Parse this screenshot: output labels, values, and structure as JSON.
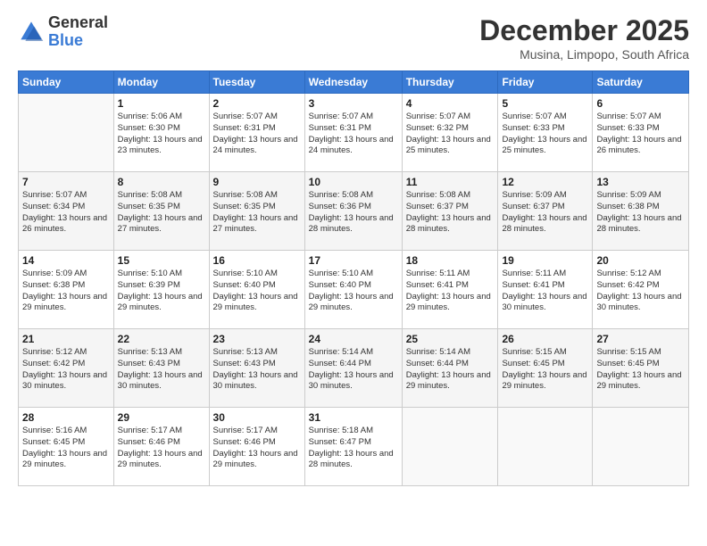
{
  "header": {
    "logo_line1": "General",
    "logo_line2": "Blue",
    "month": "December 2025",
    "location": "Musina, Limpopo, South Africa"
  },
  "weekdays": [
    "Sunday",
    "Monday",
    "Tuesday",
    "Wednesday",
    "Thursday",
    "Friday",
    "Saturday"
  ],
  "weeks": [
    [
      {
        "day": "",
        "sunrise": "",
        "sunset": "",
        "daylight": ""
      },
      {
        "day": "1",
        "sunrise": "Sunrise: 5:06 AM",
        "sunset": "Sunset: 6:30 PM",
        "daylight": "Daylight: 13 hours and 23 minutes."
      },
      {
        "day": "2",
        "sunrise": "Sunrise: 5:07 AM",
        "sunset": "Sunset: 6:31 PM",
        "daylight": "Daylight: 13 hours and 24 minutes."
      },
      {
        "day": "3",
        "sunrise": "Sunrise: 5:07 AM",
        "sunset": "Sunset: 6:31 PM",
        "daylight": "Daylight: 13 hours and 24 minutes."
      },
      {
        "day": "4",
        "sunrise": "Sunrise: 5:07 AM",
        "sunset": "Sunset: 6:32 PM",
        "daylight": "Daylight: 13 hours and 25 minutes."
      },
      {
        "day": "5",
        "sunrise": "Sunrise: 5:07 AM",
        "sunset": "Sunset: 6:33 PM",
        "daylight": "Daylight: 13 hours and 25 minutes."
      },
      {
        "day": "6",
        "sunrise": "Sunrise: 5:07 AM",
        "sunset": "Sunset: 6:33 PM",
        "daylight": "Daylight: 13 hours and 26 minutes."
      }
    ],
    [
      {
        "day": "7",
        "sunrise": "Sunrise: 5:07 AM",
        "sunset": "Sunset: 6:34 PM",
        "daylight": "Daylight: 13 hours and 26 minutes."
      },
      {
        "day": "8",
        "sunrise": "Sunrise: 5:08 AM",
        "sunset": "Sunset: 6:35 PM",
        "daylight": "Daylight: 13 hours and 27 minutes."
      },
      {
        "day": "9",
        "sunrise": "Sunrise: 5:08 AM",
        "sunset": "Sunset: 6:35 PM",
        "daylight": "Daylight: 13 hours and 27 minutes."
      },
      {
        "day": "10",
        "sunrise": "Sunrise: 5:08 AM",
        "sunset": "Sunset: 6:36 PM",
        "daylight": "Daylight: 13 hours and 28 minutes."
      },
      {
        "day": "11",
        "sunrise": "Sunrise: 5:08 AM",
        "sunset": "Sunset: 6:37 PM",
        "daylight": "Daylight: 13 hours and 28 minutes."
      },
      {
        "day": "12",
        "sunrise": "Sunrise: 5:09 AM",
        "sunset": "Sunset: 6:37 PM",
        "daylight": "Daylight: 13 hours and 28 minutes."
      },
      {
        "day": "13",
        "sunrise": "Sunrise: 5:09 AM",
        "sunset": "Sunset: 6:38 PM",
        "daylight": "Daylight: 13 hours and 28 minutes."
      }
    ],
    [
      {
        "day": "14",
        "sunrise": "Sunrise: 5:09 AM",
        "sunset": "Sunset: 6:38 PM",
        "daylight": "Daylight: 13 hours and 29 minutes."
      },
      {
        "day": "15",
        "sunrise": "Sunrise: 5:10 AM",
        "sunset": "Sunset: 6:39 PM",
        "daylight": "Daylight: 13 hours and 29 minutes."
      },
      {
        "day": "16",
        "sunrise": "Sunrise: 5:10 AM",
        "sunset": "Sunset: 6:40 PM",
        "daylight": "Daylight: 13 hours and 29 minutes."
      },
      {
        "day": "17",
        "sunrise": "Sunrise: 5:10 AM",
        "sunset": "Sunset: 6:40 PM",
        "daylight": "Daylight: 13 hours and 29 minutes."
      },
      {
        "day": "18",
        "sunrise": "Sunrise: 5:11 AM",
        "sunset": "Sunset: 6:41 PM",
        "daylight": "Daylight: 13 hours and 29 minutes."
      },
      {
        "day": "19",
        "sunrise": "Sunrise: 5:11 AM",
        "sunset": "Sunset: 6:41 PM",
        "daylight": "Daylight: 13 hours and 30 minutes."
      },
      {
        "day": "20",
        "sunrise": "Sunrise: 5:12 AM",
        "sunset": "Sunset: 6:42 PM",
        "daylight": "Daylight: 13 hours and 30 minutes."
      }
    ],
    [
      {
        "day": "21",
        "sunrise": "Sunrise: 5:12 AM",
        "sunset": "Sunset: 6:42 PM",
        "daylight": "Daylight: 13 hours and 30 minutes."
      },
      {
        "day": "22",
        "sunrise": "Sunrise: 5:13 AM",
        "sunset": "Sunset: 6:43 PM",
        "daylight": "Daylight: 13 hours and 30 minutes."
      },
      {
        "day": "23",
        "sunrise": "Sunrise: 5:13 AM",
        "sunset": "Sunset: 6:43 PM",
        "daylight": "Daylight: 13 hours and 30 minutes."
      },
      {
        "day": "24",
        "sunrise": "Sunrise: 5:14 AM",
        "sunset": "Sunset: 6:44 PM",
        "daylight": "Daylight: 13 hours and 30 minutes."
      },
      {
        "day": "25",
        "sunrise": "Sunrise: 5:14 AM",
        "sunset": "Sunset: 6:44 PM",
        "daylight": "Daylight: 13 hours and 29 minutes."
      },
      {
        "day": "26",
        "sunrise": "Sunrise: 5:15 AM",
        "sunset": "Sunset: 6:45 PM",
        "daylight": "Daylight: 13 hours and 29 minutes."
      },
      {
        "day": "27",
        "sunrise": "Sunrise: 5:15 AM",
        "sunset": "Sunset: 6:45 PM",
        "daylight": "Daylight: 13 hours and 29 minutes."
      }
    ],
    [
      {
        "day": "28",
        "sunrise": "Sunrise: 5:16 AM",
        "sunset": "Sunset: 6:45 PM",
        "daylight": "Daylight: 13 hours and 29 minutes."
      },
      {
        "day": "29",
        "sunrise": "Sunrise: 5:17 AM",
        "sunset": "Sunset: 6:46 PM",
        "daylight": "Daylight: 13 hours and 29 minutes."
      },
      {
        "day": "30",
        "sunrise": "Sunrise: 5:17 AM",
        "sunset": "Sunset: 6:46 PM",
        "daylight": "Daylight: 13 hours and 29 minutes."
      },
      {
        "day": "31",
        "sunrise": "Sunrise: 5:18 AM",
        "sunset": "Sunset: 6:47 PM",
        "daylight": "Daylight: 13 hours and 28 minutes."
      },
      {
        "day": "",
        "sunrise": "",
        "sunset": "",
        "daylight": ""
      },
      {
        "day": "",
        "sunrise": "",
        "sunset": "",
        "daylight": ""
      },
      {
        "day": "",
        "sunrise": "",
        "sunset": "",
        "daylight": ""
      }
    ]
  ]
}
